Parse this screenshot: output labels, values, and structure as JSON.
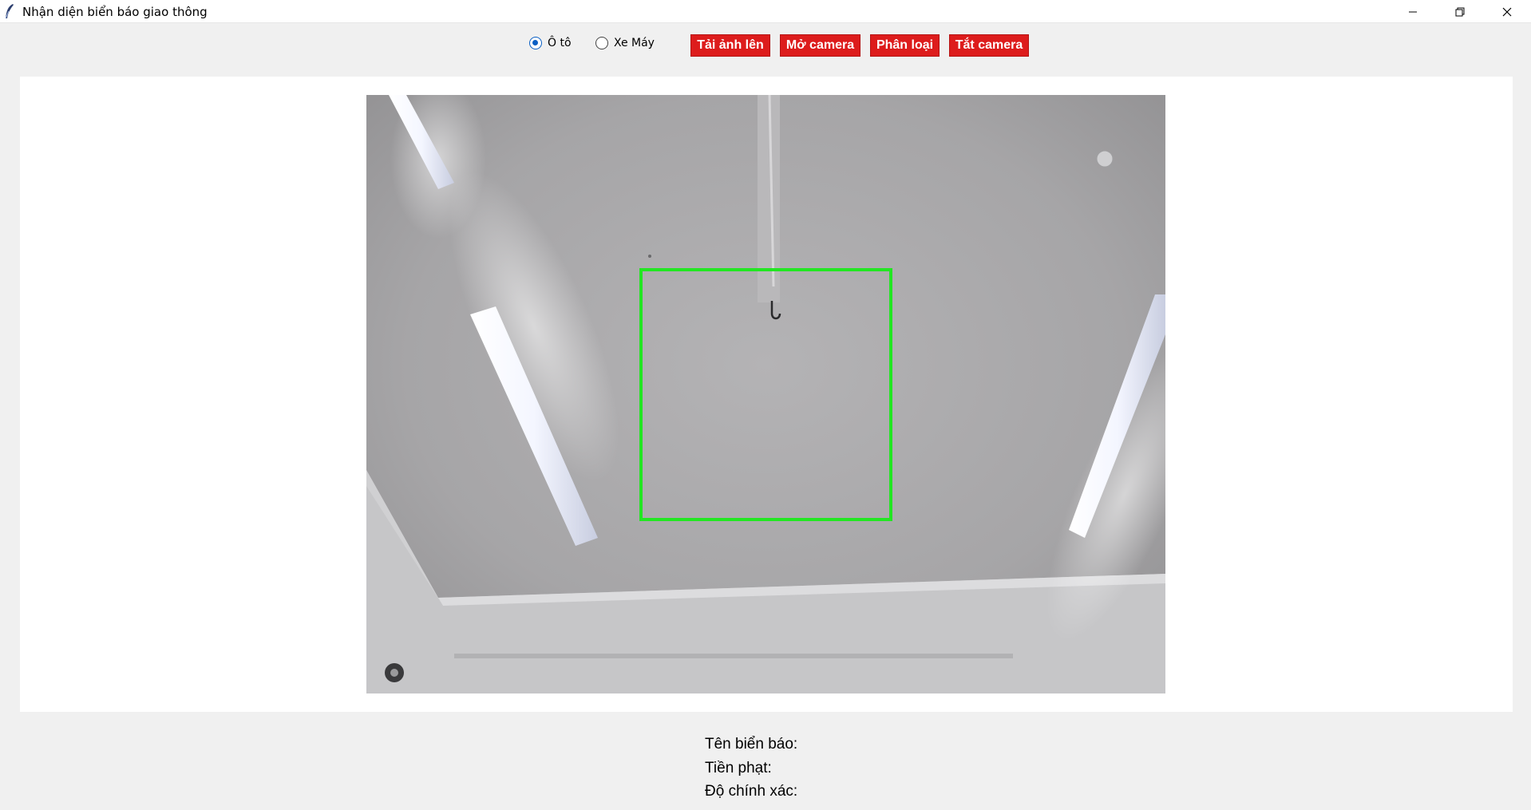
{
  "window": {
    "title": "Nhận diện biển báo giao thông",
    "icons": [
      "feather-icon",
      "minimize-icon",
      "restore-icon",
      "close-icon"
    ]
  },
  "vehicle_type": {
    "options": [
      "Ô tô",
      "Xe Máy"
    ],
    "selected": "Ô tô"
  },
  "buttons": {
    "upload": "Tải ảnh lên",
    "open_camera": "Mở camera",
    "classify": "Phân loại",
    "close_camera": "Tắt camera"
  },
  "colors": {
    "button_red": "#dd1c1c",
    "radio_blue": "#0a5fc4",
    "detection_box": "#22e622"
  },
  "results": {
    "sign_name_label": "Tên biển báo:",
    "fine_label": "Tiền phạt:",
    "accuracy_label": "Độ chính xác:"
  }
}
